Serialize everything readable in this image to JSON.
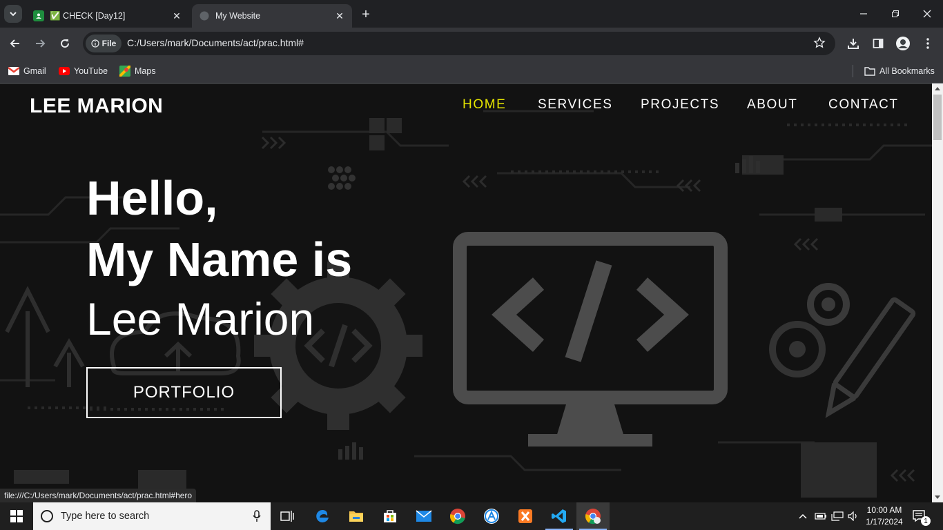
{
  "browser": {
    "tabs": [
      {
        "title": "✅ CHECK [Day12]",
        "active": false
      },
      {
        "title": "My Website",
        "active": true
      }
    ],
    "address_chip": "File",
    "url": "C:/Users/mark/Documents/act/prac.html#",
    "bookmarks": [
      "Gmail",
      "YouTube",
      "Maps"
    ],
    "all_bookmarks": "All Bookmarks",
    "status_url": "file:///C:/Users/mark/Documents/act/prac.html#hero"
  },
  "site": {
    "logo": "LEE MARION",
    "nav": [
      {
        "label": "HOME",
        "active": true
      },
      {
        "label": "SERVICES",
        "active": false
      },
      {
        "label": "PROJECTS",
        "active": false
      },
      {
        "label": "ABOUT",
        "active": false
      },
      {
        "label": "CONTACT",
        "active": false
      }
    ],
    "hero": {
      "line1": "Hello,",
      "line2": "My Name is",
      "line3": "Lee Marion",
      "button": "PORTFOLIO"
    },
    "colors": {
      "accent": "#e6e600",
      "background": "#141414"
    }
  },
  "taskbar": {
    "search_placeholder": "Type here to search",
    "time": "10:00 AM",
    "date": "1/17/2024",
    "notification_count": "1"
  }
}
